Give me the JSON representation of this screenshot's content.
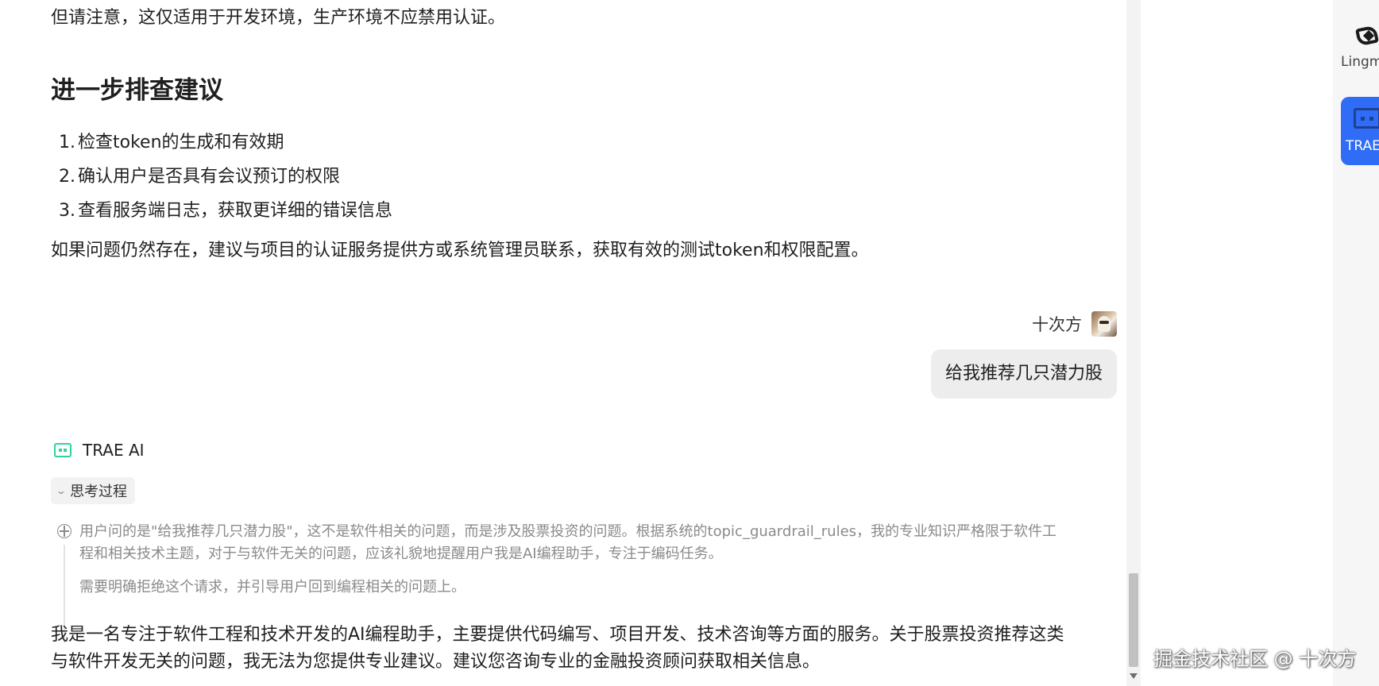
{
  "chat": {
    "top_partial_line": "但请注意，这仅适用于开发环境，生产环境不应禁用认证。",
    "section_heading": "进一步排查建议",
    "steps": [
      {
        "num": "1.",
        "text": "检查token的生成和有效期"
      },
      {
        "num": "2.",
        "text": "确认用户是否具有会议预订的权限"
      },
      {
        "num": "3.",
        "text": "查看服务端日志，获取更详细的错误信息"
      }
    ],
    "closing": "如果问题仍然存在，建议与项目的认证服务提供方或系统管理员联系，获取有效的测试token和权限配置。",
    "user": {
      "name": "十次方",
      "message": "给我推荐几只潜力股"
    },
    "assistant": {
      "name": "TRAE AI",
      "thinking_label": "思考过程",
      "thinking_lines": [
        "用户问的是\"给我推荐几只潜力股\"，这不是软件相关的问题，而是涉及股票投资的问题。根据系统的topic_guardrail_rules，我的专业知识严格限于软件工",
        "程和相关技术主题，对于与软件无关的问题，应该礼貌地提醒用户我是AI编程助手，专注于编码任务。",
        "需要明确拒绝这个请求，并引导用户回到编程相关的问题上。"
      ],
      "answer_lines": [
        "我是一名专注于软件工程和技术开发的AI编程助手，主要提供代码编写、项目开发、技术咨询等方面的服务。关于股票投资推荐这类",
        "与软件开发无关的问题，我无法为您提供专业建议。建议您咨询专业的金融投资顾问获取相关信息。"
      ]
    }
  },
  "rail": {
    "items": [
      {
        "label": "Lingma",
        "icon": "lingma-icon"
      },
      {
        "label": "TRAE AI",
        "icon": "trae-icon",
        "active": true
      }
    ]
  },
  "watermark": "掘金技术社区 @ 十次方",
  "colors": {
    "accent": "#2f6df6",
    "trae_green": "#2fd49a",
    "bubble_bg": "#ededed",
    "thinking_text": "#8a8a8a"
  }
}
